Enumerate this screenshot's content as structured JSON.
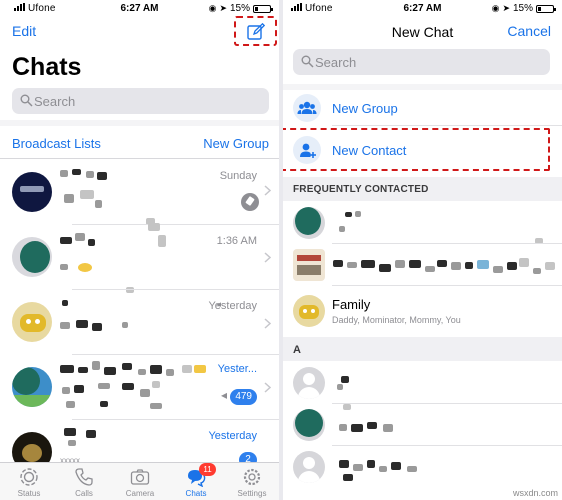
{
  "left_screen": {
    "status": {
      "carrier": "Ufone",
      "time": "6:27 AM",
      "battery": "15%"
    },
    "nav": {
      "edit": "Edit",
      "compose_icon": "compose-icon"
    },
    "title": "Chats",
    "search": {
      "placeholder": "Search"
    },
    "broadcast_lists": "Broadcast Lists",
    "new_group": "New Group",
    "chats": [
      {
        "time": "Sunday",
        "pinned": true
      },
      {
        "time": "1:36 AM"
      },
      {
        "time": "Yesterday"
      },
      {
        "time": "Yester...",
        "unread": "479",
        "muted": true
      },
      {
        "time": "Yesterday",
        "unread": "2",
        "preview": "xxxxx"
      }
    ],
    "tabs": [
      {
        "label": "Status",
        "icon": "status-icon"
      },
      {
        "label": "Calls",
        "icon": "calls-icon"
      },
      {
        "label": "Camera",
        "icon": "camera-icon"
      },
      {
        "label": "Chats",
        "icon": "chats-icon",
        "badge": "11",
        "active": true
      },
      {
        "label": "Settings",
        "icon": "settings-icon"
      }
    ]
  },
  "right_screen": {
    "status": {
      "carrier": "Ufone",
      "time": "6:27 AM",
      "battery": "15%"
    },
    "nav": {
      "title": "New Chat",
      "cancel": "Cancel"
    },
    "search": {
      "placeholder": "Search"
    },
    "actions": [
      {
        "label": "New Group",
        "icon": "group-icon"
      },
      {
        "label": "New Contact",
        "icon": "add-contact-icon"
      }
    ],
    "sections": {
      "frequent": "FREQUENTLY CONTACTED",
      "a": "A"
    },
    "family": {
      "name": "Family",
      "members": "Daddy, Mominator, Mommy, You"
    }
  },
  "watermark": "wsxdn.com",
  "colors": {
    "accent": "#1a73e8",
    "highlight": "#d01818",
    "badge": "#2f80ed",
    "tab_badge": "#ff3b30"
  }
}
